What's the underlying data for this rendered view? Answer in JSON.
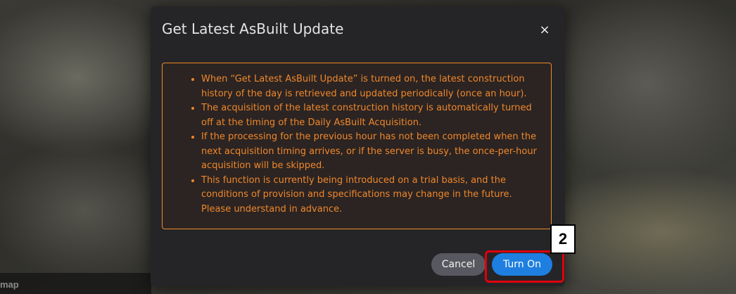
{
  "background": {
    "map_label": "map"
  },
  "dialog": {
    "title": "Get Latest AsBuilt Update",
    "close_label": "×",
    "notice": {
      "border_color": "#f08a24",
      "text_color": "#f0872c",
      "items": [
        "When “Get Latest AsBuilt Update” is turned on, the latest construction history of the day is retrieved and updated periodically (once an hour).",
        "The acquisition of the latest construction history is automatically turned off at the timing of the Daily AsBuilt Acquisition.",
        "If the processing for the previous hour has not been completed when the next acquisition timing arrives, or if the server is busy, the once-per-hour acquisition will be skipped.",
        "This function is currently being introduced on a trial basis, and the conditions of provision and specifications may change in the future. Please understand in advance."
      ]
    },
    "buttons": {
      "cancel_label": "Cancel",
      "turn_on_label": "Turn On",
      "primary_color": "#1e7fe0",
      "secondary_color": "#585860"
    }
  },
  "annotation": {
    "step_number": "2",
    "highlight_color": "#e0000c"
  }
}
